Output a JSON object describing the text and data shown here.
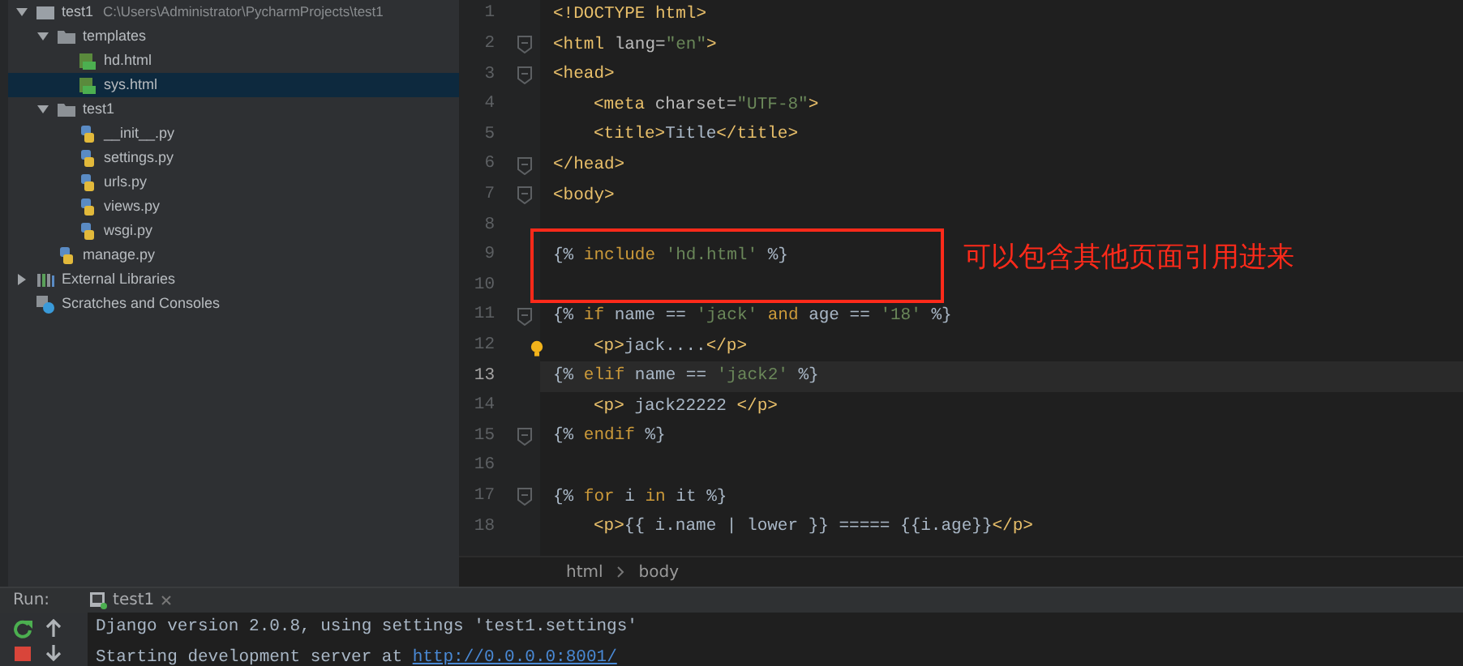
{
  "project_tree": [
    {
      "name": "test1",
      "path": "C:\\Users\\Administrator\\PycharmProjects\\test1",
      "kind": "project",
      "expanded": true,
      "selected": false,
      "children": [
        {
          "name": "templates",
          "kind": "folder",
          "expanded": true,
          "selected": false,
          "children": [
            {
              "name": "hd.html",
              "kind": "html",
              "selected": false
            },
            {
              "name": "sys.html",
              "kind": "html",
              "selected": true
            }
          ]
        },
        {
          "name": "test1",
          "kind": "folder",
          "expanded": true,
          "selected": false,
          "children": [
            {
              "name": "__init__.py",
              "kind": "python",
              "selected": false
            },
            {
              "name": "settings.py",
              "kind": "python",
              "selected": false
            },
            {
              "name": "urls.py",
              "kind": "python",
              "selected": false
            },
            {
              "name": "views.py",
              "kind": "python",
              "selected": false
            },
            {
              "name": "wsgi.py",
              "kind": "python",
              "selected": false
            }
          ]
        },
        {
          "name": "manage.py",
          "kind": "python",
          "selected": false
        }
      ]
    },
    {
      "name": "External Libraries",
      "kind": "libraries",
      "expanded": false,
      "selected": false
    },
    {
      "name": "Scratches and Consoles",
      "kind": "scratches",
      "selected": false
    }
  ],
  "editor": {
    "lines": [
      {
        "number": "1",
        "fold": false,
        "bulb": false,
        "current": false,
        "segments": [
          {
            "text": "<!DOCTYPE html>",
            "kind": "tag"
          }
        ]
      },
      {
        "number": "2",
        "fold": true,
        "bulb": false,
        "current": false,
        "segments": [
          {
            "text": "<html",
            "kind": "tag"
          },
          {
            "text": " lang=",
            "kind": "attr"
          },
          {
            "text": "\"en\"",
            "kind": "string"
          },
          {
            "text": ">",
            "kind": "tag"
          }
        ]
      },
      {
        "number": "3",
        "fold": true,
        "bulb": false,
        "current": false,
        "segments": [
          {
            "text": "<head>",
            "kind": "tag"
          }
        ]
      },
      {
        "number": "4",
        "fold": false,
        "bulb": false,
        "current": false,
        "indented": true,
        "segments": [
          {
            "text": "<meta",
            "kind": "tag"
          },
          {
            "text": " charset=",
            "kind": "attr"
          },
          {
            "text": "\"UTF-8\"",
            "kind": "string"
          },
          {
            "text": ">",
            "kind": "tag"
          }
        ]
      },
      {
        "number": "5",
        "fold": false,
        "bulb": false,
        "current": false,
        "indented": true,
        "segments": [
          {
            "text": "<title>",
            "kind": "tag"
          },
          {
            "text": "Title",
            "kind": "plain"
          },
          {
            "text": "</title>",
            "kind": "tag"
          }
        ]
      },
      {
        "number": "6",
        "fold": true,
        "bulb": false,
        "current": false,
        "segments": [
          {
            "text": "</head>",
            "kind": "tag"
          }
        ]
      },
      {
        "number": "7",
        "fold": true,
        "bulb": false,
        "current": false,
        "segments": [
          {
            "text": "<body>",
            "kind": "tag"
          }
        ]
      },
      {
        "number": "8",
        "fold": false,
        "bulb": false,
        "current": false
      },
      {
        "number": "9",
        "fold": false,
        "bulb": false,
        "current": false,
        "segments": [
          {
            "text": "{%",
            "kind": "plain"
          },
          {
            "text": " include ",
            "kind": "keyword"
          },
          {
            "text": "'hd.html'",
            "kind": "string"
          },
          {
            "text": " %}",
            "kind": "plain"
          }
        ]
      },
      {
        "number": "10",
        "fold": false,
        "bulb": false,
        "current": false
      },
      {
        "number": "11",
        "fold": true,
        "bulb": false,
        "current": false,
        "segments": [
          {
            "text": "{%",
            "kind": "plain"
          },
          {
            "text": " if ",
            "kind": "keyword"
          },
          {
            "text": "name == ",
            "kind": "plain"
          },
          {
            "text": "'jack'",
            "kind": "string"
          },
          {
            "text": " and ",
            "kind": "keyword"
          },
          {
            "text": "age == ",
            "kind": "plain"
          },
          {
            "text": "'18'",
            "kind": "string"
          },
          {
            "text": " %}",
            "kind": "plain"
          }
        ]
      },
      {
        "number": "12",
        "fold": false,
        "bulb": true,
        "current": false,
        "indented": true,
        "segments": [
          {
            "text": "<p>",
            "kind": "tag"
          },
          {
            "text": "jack....",
            "kind": "plain"
          },
          {
            "text": "</p>",
            "kind": "tag"
          }
        ]
      },
      {
        "number": "13",
        "fold": false,
        "bulb": false,
        "current": true,
        "segments": [
          {
            "text": "{%",
            "kind": "plain"
          },
          {
            "text": " elif ",
            "kind": "keyword"
          },
          {
            "text": "name == ",
            "kind": "plain"
          },
          {
            "text": "'jack2'",
            "kind": "string"
          },
          {
            "text": " %}",
            "kind": "plain"
          }
        ]
      },
      {
        "number": "14",
        "fold": false,
        "bulb": false,
        "current": false,
        "indented": true,
        "segments": [
          {
            "text": "<p>",
            "kind": "tag"
          },
          {
            "text": " jack22222 ",
            "kind": "plain"
          },
          {
            "text": "</p>",
            "kind": "tag"
          }
        ]
      },
      {
        "number": "15",
        "fold": true,
        "bulb": false,
        "current": false,
        "segments": [
          {
            "text": "{%",
            "kind": "plain"
          },
          {
            "text": " endif ",
            "kind": "keyword"
          },
          {
            "text": "%}",
            "kind": "plain"
          }
        ]
      },
      {
        "number": "16",
        "fold": false,
        "bulb": false,
        "current": false
      },
      {
        "number": "17",
        "fold": true,
        "bulb": false,
        "current": false,
        "segments": [
          {
            "text": "{%",
            "kind": "plain"
          },
          {
            "text": " for ",
            "kind": "keyword"
          },
          {
            "text": "i ",
            "kind": "plain"
          },
          {
            "text": "in",
            "kind": "keyword"
          },
          {
            "text": " it ",
            "kind": "plain"
          },
          {
            "text": "%}",
            "kind": "plain"
          }
        ]
      },
      {
        "number": "18",
        "fold": false,
        "bulb": false,
        "current": false,
        "indented": true,
        "segments": [
          {
            "text": "<p>",
            "kind": "tag"
          },
          {
            "text": "{{ i.name | lower }} ===== {{i.age}}",
            "kind": "plain"
          },
          {
            "text": "</p>",
            "kind": "tag"
          }
        ]
      }
    ],
    "breadcrumbs": [
      "html",
      "body"
    ]
  },
  "annotation": {
    "text": "可以包含其他页面引用进来"
  },
  "run_panel": {
    "label": "Run:",
    "tab": "test1",
    "console_lines": [
      [
        {
          "text": "Django version 2.0.8, using settings 'test1.settings'",
          "kind": "text"
        }
      ],
      [
        {
          "text": "Starting development server at ",
          "kind": "text"
        },
        {
          "text": "http://0.0.0.0:8001/",
          "kind": "link"
        }
      ]
    ]
  }
}
